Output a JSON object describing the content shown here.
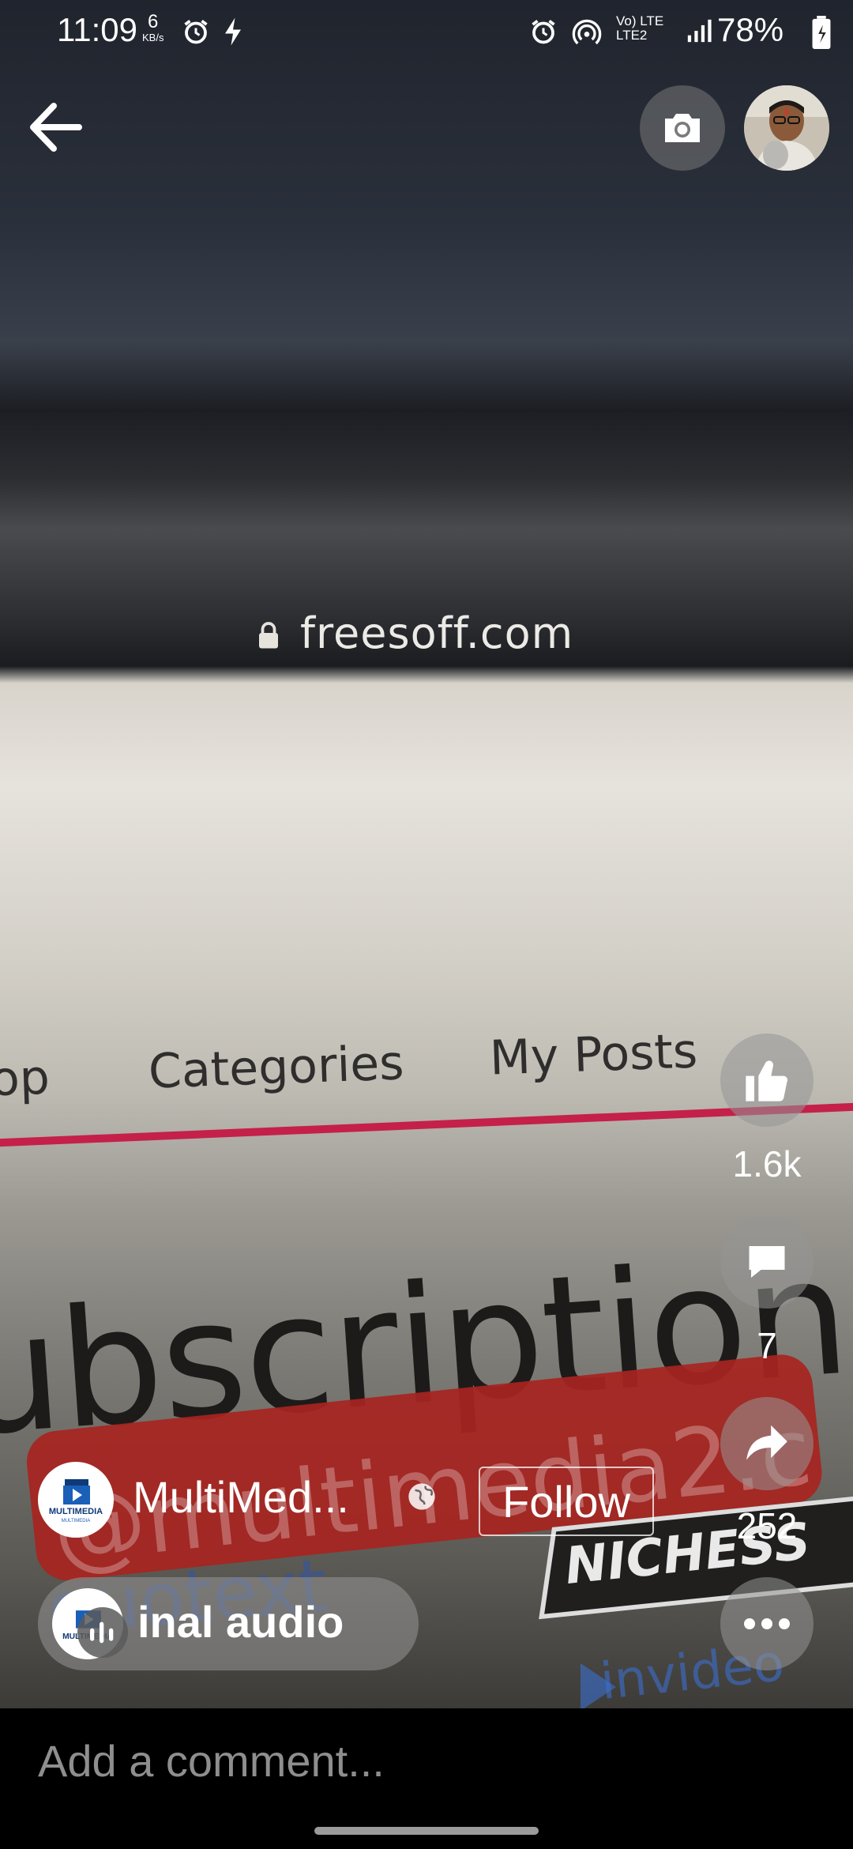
{
  "status_bar": {
    "time": "11:09",
    "net_speed": "6",
    "net_unit": "KB/s",
    "network": "Vo) LTE LTE2",
    "battery": "78%"
  },
  "video": {
    "url": "freesoff.com",
    "nav_items": [
      "op",
      "Categories",
      "My Posts"
    ],
    "headline": "ubscriptions",
    "banner_text": "@multimedia2.c",
    "quote_text": "quotext",
    "badge_text": "NICHESS",
    "brand_text": "invideo"
  },
  "actions": {
    "likes": "1.6k",
    "comments": "7",
    "shares": "252"
  },
  "page": {
    "name": "MultiMed...",
    "avatar_text": "MULTIMEDIA",
    "follow_label": "Follow"
  },
  "audio": {
    "label": "inal audio"
  },
  "comment": {
    "placeholder": "Add a comment..."
  },
  "icons": {
    "back": "arrow-left-icon",
    "camera": "camera-icon",
    "like": "thumbs-up-icon",
    "comment": "comment-bubble-icon",
    "share": "share-arrow-icon",
    "more": "more-dots-icon",
    "globe": "globe-icon"
  }
}
